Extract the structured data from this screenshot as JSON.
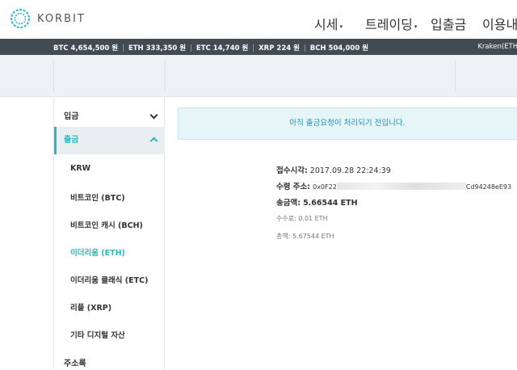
{
  "header": {
    "logo_text": "KORBIT",
    "nav": [
      {
        "label": "시세",
        "caret": "▾"
      },
      {
        "label": "트레이딩",
        "caret": "▾"
      },
      {
        "label": "입출금",
        "caret": ""
      },
      {
        "label": "이용내역",
        "caret": ""
      }
    ]
  },
  "ticker": {
    "items": [
      "BTC 4,654,500 원",
      "ETH 333,350 원",
      "ETC 14,740 원",
      "XRP 224 원",
      "BCH 504,000 원"
    ],
    "separator": "|",
    "right_text": "Kraken(ETH/"
  },
  "sidebar": {
    "deposit": "입금",
    "withdraw": "출금",
    "sub_items": [
      {
        "label": "KRW",
        "active": false
      },
      {
        "label": "비트코인 (BTC)",
        "active": false
      },
      {
        "label": "비트코인 캐시 (BCH)",
        "active": false
      },
      {
        "label": "이더리움 (ETH)",
        "active": true
      },
      {
        "label": "이더리움 클래식 (ETC)",
        "active": false
      },
      {
        "label": "리플 (XRP)",
        "active": false
      },
      {
        "label": "기타 디지털 자산",
        "active": false
      }
    ],
    "address_book": "주소록"
  },
  "main": {
    "notice": "아직 출금요청이 처리되기 전입니다.",
    "received_at_label": "접수시각:",
    "received_at_value": "2017.09.28 22:24:39",
    "address_label": "수령 주소:",
    "address_prefix": "0x0F22",
    "address_suffix": "Cd94248eE93",
    "amount_label": "송금액:",
    "amount_value": "5.66544 ETH",
    "fee_label": "수수료:",
    "fee_value": "0.01 ETH",
    "total_label": "총액:",
    "total_value": "5.67544 ETH"
  },
  "colors": {
    "accent": "#2cb5c0",
    "ticker_bg": "#424a52",
    "notice_bg": "#e5f5f8"
  }
}
